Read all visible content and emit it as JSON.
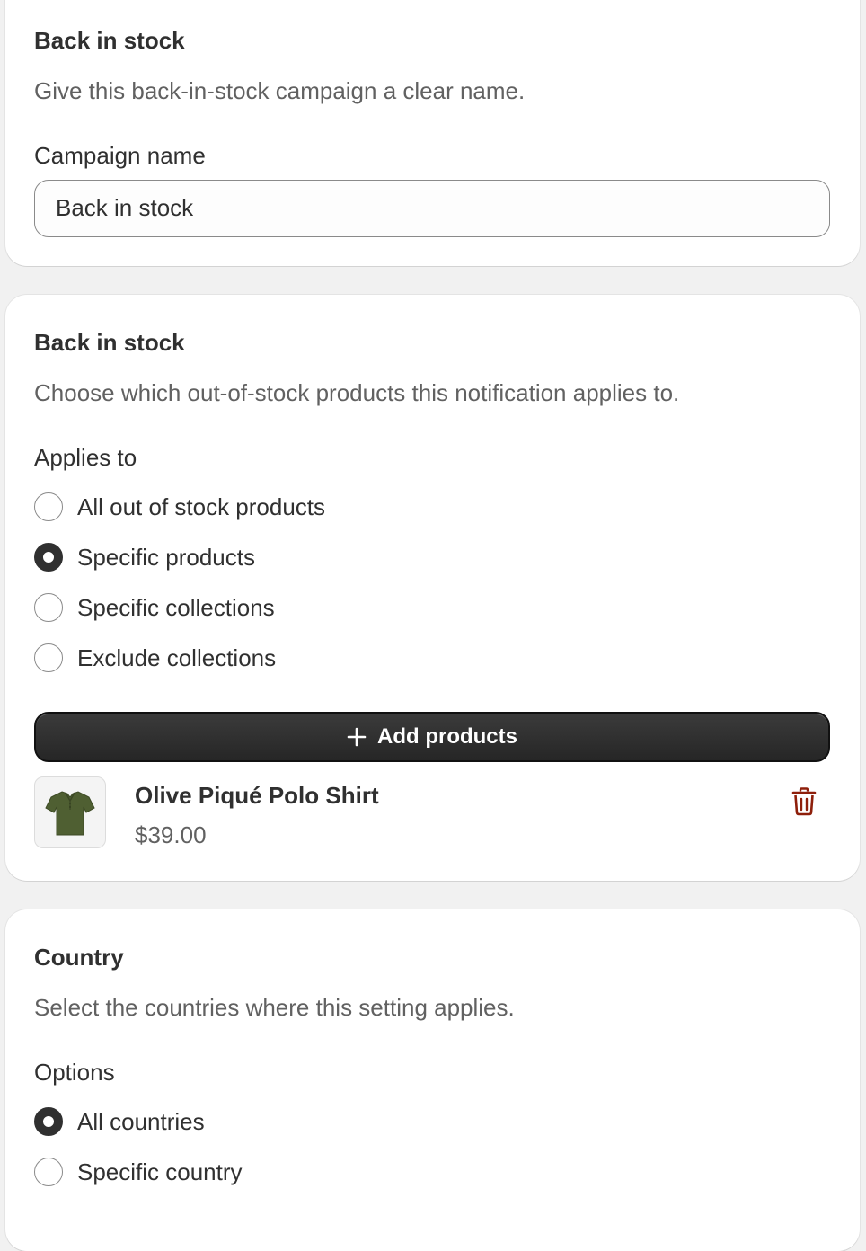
{
  "campaign_card": {
    "title": "Back in stock",
    "description": "Give this back-in-stock campaign a clear name.",
    "field_label": "Campaign name",
    "field_value": "Back in stock"
  },
  "products_card": {
    "title": "Back in stock",
    "description": "Choose which out-of-stock products this notification applies to.",
    "applies_label": "Applies to",
    "options": [
      {
        "label": "All out of stock products",
        "checked": false
      },
      {
        "label": "Specific products",
        "checked": true
      },
      {
        "label": "Specific collections",
        "checked": false
      },
      {
        "label": "Exclude collections",
        "checked": false
      }
    ],
    "add_button_label": "Add products",
    "product": {
      "name": "Olive Piqué Polo Shirt",
      "price": "$39.00",
      "thumbnail_icon": "polo-shirt-image"
    },
    "delete_icon": "trash-icon"
  },
  "country_card": {
    "title": "Country",
    "description": "Select the countries where this setting applies.",
    "options_label": "Options",
    "options": [
      {
        "label": "All countries",
        "checked": true
      },
      {
        "label": "Specific country",
        "checked": false
      }
    ]
  },
  "colors": {
    "delete_red": "#8e1f0b",
    "shirt_olive": "#4f5f32",
    "primary_button": "#303030"
  }
}
